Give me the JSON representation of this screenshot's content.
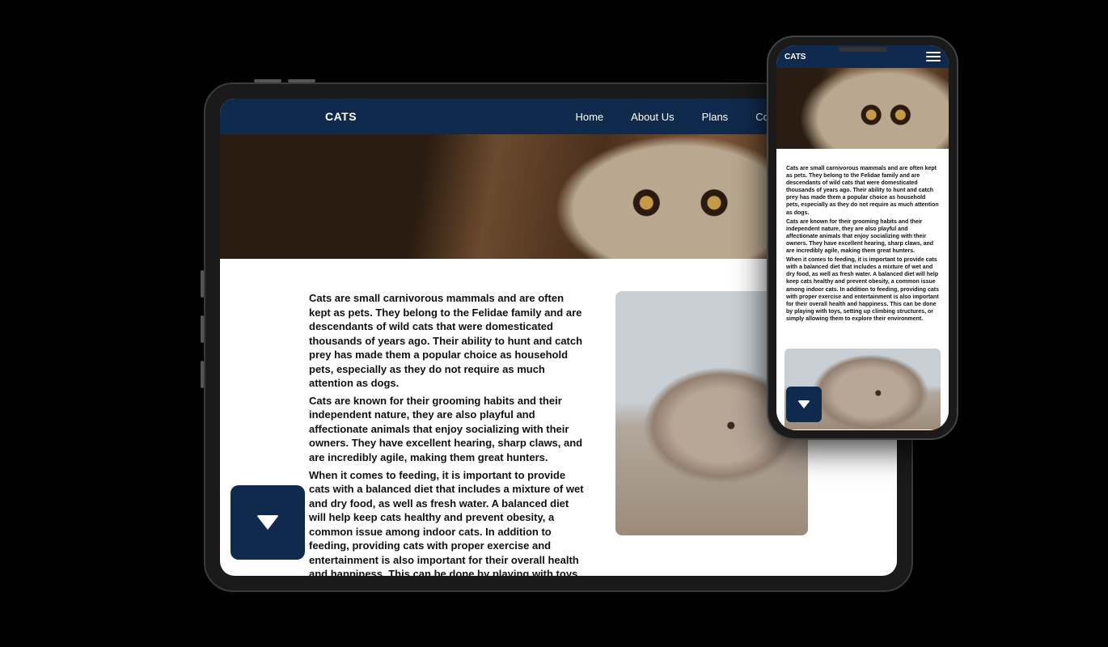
{
  "site_title": "CATS",
  "nav": {
    "items": [
      {
        "label": "Home"
      },
      {
        "label": "About Us"
      },
      {
        "label": "Plans"
      },
      {
        "label": "Contact"
      }
    ]
  },
  "content": {
    "p1": "Cats are small carnivorous mammals and are often kept as pets. They belong to the Felidae family and are descendants of wild cats that were domesticated thousands of years ago. Their ability to hunt and catch prey has made them a popular choice as household pets, especially as they do not require as much attention as dogs.",
    "p2": "Cats are known for their grooming habits and their independent nature, they are also playful and affectionate animals that enjoy socializing with their owners. They have excellent hearing, sharp claws, and are incredibly agile, making them great hunters.",
    "p3": "When it comes to feeding, it is important to provide cats with a balanced diet that includes a mixture of wet and dry food, as well as fresh water. A balanced diet will help keep cats healthy and prevent obesity, a common issue among indoor cats. In addition to feeding, providing cats with proper exercise and entertainment is also important for their overall health and happiness. This can be done by playing with toys, setting up climbing structures, or simply allowing them to explore their environment."
  },
  "colors": {
    "header_bg": "#102a4d",
    "page_bg": "#000000"
  }
}
